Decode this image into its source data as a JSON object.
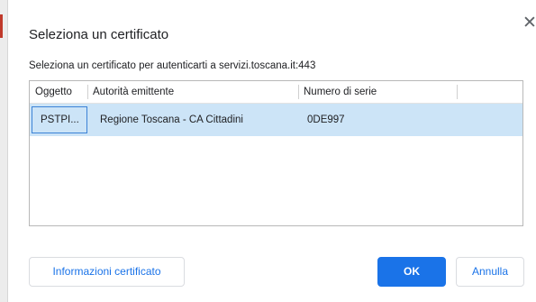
{
  "dialog": {
    "title": "Seleziona un certificato",
    "subtitle": "Seleziona un certificato per autenticarti a servizi.toscana.it:443",
    "close_icon": "close-icon"
  },
  "table": {
    "columns": [
      "Oggetto",
      "Autorità emittente",
      "Numero di serie",
      ""
    ],
    "rows": [
      {
        "oggetto": "PSTPI...",
        "autorita": "Regione Toscana - CA Cittadini",
        "numero": "0DE997",
        "selected": true
      }
    ]
  },
  "buttons": {
    "info": "Informazioni certificato",
    "ok": "OK",
    "cancel": "Annulla"
  },
  "colors": {
    "accent": "#1a73e8",
    "selected_row": "#cce4f7"
  }
}
